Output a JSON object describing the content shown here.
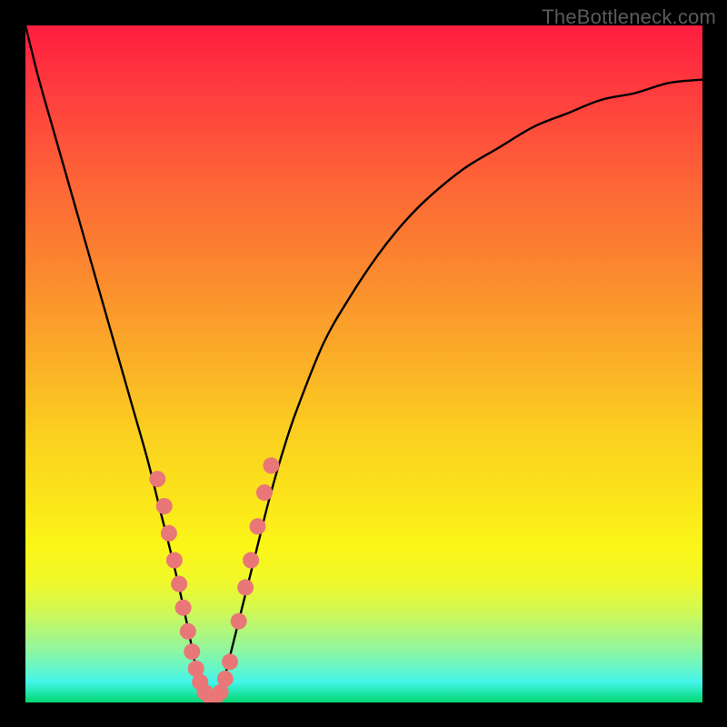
{
  "watermark": "TheBottleneck.com",
  "chart_data": {
    "type": "line",
    "title": "",
    "xlabel": "",
    "ylabel": "",
    "xlim": [
      0,
      100
    ],
    "ylim": [
      0,
      100
    ],
    "series": [
      {
        "name": "bottleneck-curve",
        "x": [
          0,
          2,
          4,
          6,
          8,
          10,
          12,
          14,
          16,
          18,
          20,
          22,
          24,
          25,
          26,
          27,
          28,
          29,
          30,
          32,
          34,
          36,
          38,
          40,
          44,
          48,
          52,
          56,
          60,
          65,
          70,
          75,
          80,
          85,
          90,
          95,
          100
        ],
        "values": [
          100,
          92,
          85,
          78,
          71,
          64,
          57,
          50,
          43,
          36,
          28,
          20,
          11,
          6,
          2,
          0,
          0,
          2,
          6,
          14,
          22,
          30,
          37,
          43,
          53,
          60,
          66,
          71,
          75,
          79,
          82,
          85,
          87,
          89,
          90,
          91.5,
          92
        ]
      }
    ],
    "highlight_points": {
      "name": "sample-markers",
      "color": "#e97777",
      "points": [
        {
          "x": 19.5,
          "y": 33
        },
        {
          "x": 20.5,
          "y": 29
        },
        {
          "x": 21.2,
          "y": 25
        },
        {
          "x": 22.0,
          "y": 21
        },
        {
          "x": 22.7,
          "y": 17.5
        },
        {
          "x": 23.3,
          "y": 14
        },
        {
          "x": 24.0,
          "y": 10.5
        },
        {
          "x": 24.6,
          "y": 7.5
        },
        {
          "x": 25.2,
          "y": 5
        },
        {
          "x": 25.8,
          "y": 3
        },
        {
          "x": 26.5,
          "y": 1.5
        },
        {
          "x": 27.3,
          "y": 0.8
        },
        {
          "x": 28.0,
          "y": 0.7
        },
        {
          "x": 28.8,
          "y": 1.5
        },
        {
          "x": 29.5,
          "y": 3.5
        },
        {
          "x": 30.2,
          "y": 6
        },
        {
          "x": 31.5,
          "y": 12
        },
        {
          "x": 32.5,
          "y": 17
        },
        {
          "x": 33.3,
          "y": 21
        },
        {
          "x": 34.3,
          "y": 26
        },
        {
          "x": 35.3,
          "y": 31
        },
        {
          "x": 36.3,
          "y": 35
        }
      ]
    },
    "gradient_stops": [
      {
        "pos": 0,
        "color": "#fe1d3f"
      },
      {
        "pos": 50,
        "color": "#fbcf20"
      },
      {
        "pos": 80,
        "color": "#f0f82a"
      },
      {
        "pos": 100,
        "color": "#00d872"
      }
    ]
  }
}
